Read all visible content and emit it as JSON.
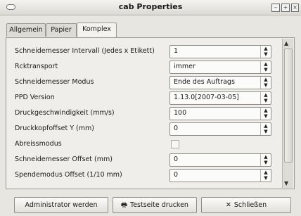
{
  "window": {
    "title": "cab Properties",
    "menu_icon": "window-menu-icon",
    "buttons": [
      {
        "icon": "minimize-icon",
        "glyph": "–"
      },
      {
        "icon": "maximize-icon",
        "glyph": "+"
      },
      {
        "icon": "close-icon",
        "glyph": "×"
      }
    ]
  },
  "tabs": [
    {
      "label": "Allgemein",
      "active": false
    },
    {
      "label": "Papier",
      "active": false
    },
    {
      "label": "Komplex",
      "active": true
    }
  ],
  "settings": [
    {
      "label": "Schneidemesser Intervall (Jedes x Etikett)",
      "control": "combo",
      "value": "1"
    },
    {
      "label": "Rcktransport",
      "control": "combo",
      "value": "immer"
    },
    {
      "label": "Schneidemesser Modus",
      "control": "combo",
      "value": "Ende des Auftrags"
    },
    {
      "label": "PPD Version",
      "control": "combo",
      "value": "1.13.0[2007-03-05]"
    },
    {
      "label": "Druckgeschwindigkeit (mm/s)",
      "control": "combo",
      "value": "100"
    },
    {
      "label": "Druckkopfoffset Y (mm)",
      "control": "combo",
      "value": "0"
    },
    {
      "label": "Abreissmodus",
      "control": "checkbox",
      "value": "unchecked"
    },
    {
      "label": "Schneidemesser Offset (mm)",
      "control": "combo",
      "value": "0"
    },
    {
      "label": "Spendemodus Offset (1/10 mm)",
      "control": "combo",
      "value": "0"
    }
  ],
  "buttons": {
    "admin": "Administrator werden",
    "testpage": "Testseite drucken",
    "close": "Schließen"
  }
}
